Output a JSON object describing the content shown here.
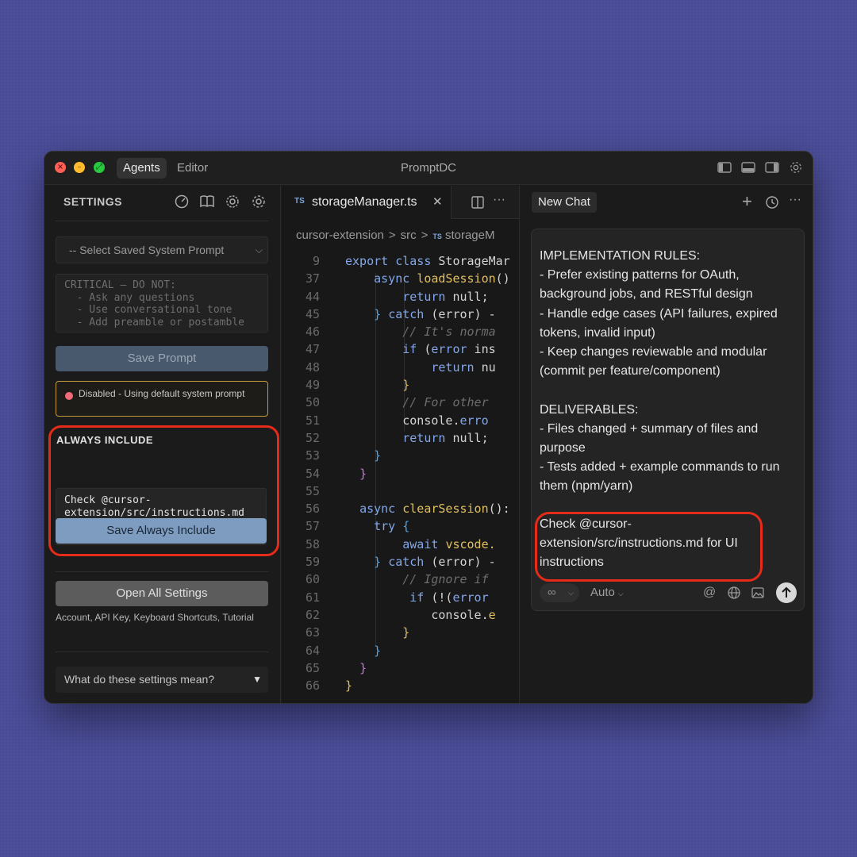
{
  "window": {
    "title": "PromptDC",
    "tabs": [
      "Agents",
      "Editor"
    ],
    "active_tab": "Agents"
  },
  "sidebar": {
    "title": "SETTINGS",
    "select_placeholder": "-- Select Saved System Prompt",
    "system_prompt_text": "CRITICAL – DO NOT:\n  - Ask any questions\n  - Use conversational tone\n  - Add preamble or postamble",
    "save_prompt_label": "Save Prompt",
    "status_text": "Disabled - Using default system prompt",
    "status_color": "#f06a7a",
    "always_include_title": "ALWAYS INCLUDE",
    "always_include_text": "Check @cursor-\nextension/src/instructions.md\nfor UI instructions",
    "save_always_label": "Save Always Include",
    "open_settings_label": "Open All Settings",
    "open_settings_desc": "Account, API Key, Keyboard Shortcuts, Tutorial",
    "faq_label": "What do these settings mean?"
  },
  "editor": {
    "tab_badge": "TS",
    "tab_name": "storageManager.ts",
    "breadcrumb": [
      "cursor-extension",
      "src",
      "storageM"
    ],
    "lines": [
      {
        "n": "9",
        "html": "<span class=\"kw\">export class</span> StorageMar"
      },
      {
        "n": "37",
        "html": "    <span class=\"kw\">async</span> <span class=\"fn\">loadSession</span>()"
      },
      {
        "n": "44",
        "html": "        <span class=\"kw\">return</span> null;"
      },
      {
        "n": "45",
        "html": "    <span class=\"br3\">}</span> <span class=\"kw\">catch</span> (error) -"
      },
      {
        "n": "46",
        "html": "        <span class=\"cm\">// It's norma</span>"
      },
      {
        "n": "47",
        "html": "        <span class=\"kw\">if</span> (<span class=\"kw\">error</span> ins"
      },
      {
        "n": "48",
        "html": "            <span class=\"kw\">return</span> nu"
      },
      {
        "n": "49",
        "html": "        <span class=\"fn\">}</span>"
      },
      {
        "n": "50",
        "html": "        <span class=\"cm\">// For other</span>"
      },
      {
        "n": "51",
        "html": "        console.<span class=\"kw\">erro</span>"
      },
      {
        "n": "52",
        "html": "        <span class=\"kw\">return</span> null;"
      },
      {
        "n": "53",
        "html": "    <span class=\"br3\">}</span>"
      },
      {
        "n": "54",
        "html": "  <span class=\"br2\">}</span>"
      },
      {
        "n": "55",
        "html": ""
      },
      {
        "n": "56",
        "html": "  <span class=\"kw\">async</span> <span class=\"fn\">clearSession</span>():"
      },
      {
        "n": "57",
        "html": "    <span class=\"kw\">try</span> <span class=\"br3\">{</span>"
      },
      {
        "n": "58",
        "html": "        <span class=\"kw\">await</span> <span class=\"fn\">vscode.</span>"
      },
      {
        "n": "59",
        "html": "    <span class=\"br3\">}</span> <span class=\"kw\">catch</span> (error) -"
      },
      {
        "n": "60",
        "html": "        <span class=\"cm\">// Ignore if</span>"
      },
      {
        "n": "61",
        "html": "         <span class=\"kw\">if</span> (!(<span class=\"kw\">error</span>"
      },
      {
        "n": "62",
        "html": "            console.<span class=\"fn\">e</span>"
      },
      {
        "n": "63",
        "html": "        <span class=\"fn\">}</span>"
      },
      {
        "n": "64",
        "html": "    <span class=\"br3\">}</span>"
      },
      {
        "n": "65",
        "html": "  <span class=\"br2\">}</span>"
      },
      {
        "n": "66",
        "html": "<span class=\"fn\">}</span>"
      }
    ]
  },
  "chat": {
    "tab_label": "New Chat",
    "message": "IMPLEMENTATION RULES:\n- Prefer existing patterns for OAuth, background jobs, and RESTful design\n- Handle edge cases (API failures, expired tokens, invalid input)\n- Keep changes reviewable and modular (commit per feature/component)\n\nDELIVERABLES:\n- Files changed + summary of files and purpose\n- Tests added + example commands to run them (npm/yarn)",
    "inserted_text": "Check @cursor-extension/src/instructions.md for UI instructions",
    "mode_symbol": "∞",
    "model_label": "Auto"
  },
  "colors": {
    "highlight_ring": "#e52b1a",
    "accent_button": "#7e9cc0",
    "background": "#4a4c98"
  }
}
